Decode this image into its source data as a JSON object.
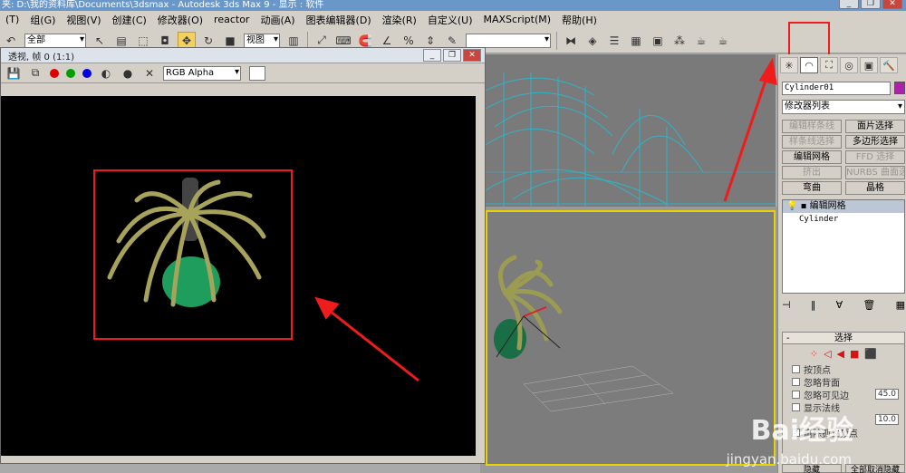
{
  "window": {
    "title": "夹: D:\\我的资料库\\Documents\\3dsmax  - Autodesk 3ds Max 9  - 显示 : 软件"
  },
  "menu": [
    "(T)",
    "组(G)",
    "视图(V)",
    "创建(C)",
    "修改器(O)",
    "reactor",
    "动画(A)",
    "图表编辑器(D)",
    "渲染(R)",
    "自定义(U)",
    "MAXScript(M)",
    "帮助(H)"
  ],
  "toolbar": {
    "selection_filter": "全部",
    "reference_coord": "视图",
    "named_selection": ""
  },
  "render_window": {
    "title": "透视, 帧 0 (1:1)",
    "channel": "RGB Alpha",
    "colors": {
      "red": "#e00000",
      "green": "#00a000",
      "blue": "#0000e0"
    }
  },
  "command_panel": {
    "object_name": "Cylinder01",
    "object_color": "#b01eac",
    "modifier_list": "修改器列表",
    "buttons": [
      {
        "label": "编辑样条线",
        "enabled": false
      },
      {
        "label": "面片选择",
        "enabled": true
      },
      {
        "label": "样条线选择",
        "enabled": false
      },
      {
        "label": "多边形选择",
        "enabled": true
      },
      {
        "label": "编辑网格",
        "enabled": true
      },
      {
        "label": "FFD 选择",
        "enabled": false
      },
      {
        "label": "挤出",
        "enabled": false
      },
      {
        "label": "NURBS 曲面选择",
        "enabled": false
      },
      {
        "label": "弯曲",
        "enabled": true
      },
      {
        "label": "晶格",
        "enabled": true
      }
    ],
    "stack": {
      "selected": "编辑网格",
      "base": "Cylinder"
    },
    "selection_rollout": {
      "title": "选择",
      "options": [
        "按顶点",
        "忽略背面",
        "忽略可见边",
        "显示法线",
        "删除孤立顶点"
      ],
      "angle_value": "45.0",
      "scale_value": "10.0"
    },
    "bottom_buttons": [
      "隐藏",
      "全部取消隐藏"
    ]
  },
  "watermark": {
    "brand": "Bai经验",
    "url": "jingyan.baidu.com"
  }
}
